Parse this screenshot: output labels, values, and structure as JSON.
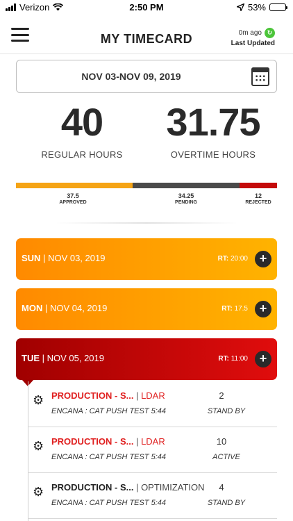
{
  "status_bar": {
    "carrier": "Verizon",
    "time": "2:50 PM",
    "battery": "53%",
    "battery_level": 0.53
  },
  "header": {
    "title": "MY TIMECARD",
    "updated_ago": "0m ago",
    "updated_label": "Last Updated"
  },
  "date_range": {
    "label": "NOV 03-NOV 09, 2019"
  },
  "hours": {
    "regular": {
      "value": "40",
      "label": "REGULAR HOURS"
    },
    "overtime": {
      "value": "31.75",
      "label": "OVERTIME HOURS"
    }
  },
  "breakdown": [
    {
      "value": "37.5",
      "label": "APPROVED",
      "color": "#f5a415"
    },
    {
      "value": "34.25",
      "label": "PENDING",
      "color": "#4a4a4a"
    },
    {
      "value": "12",
      "label": "REJECTED",
      "color": "#c40a0a"
    }
  ],
  "days": [
    {
      "day": "SUN",
      "date": "| NOV 03, 2019",
      "rt_label": "RT:",
      "rt_value": "20:00",
      "style": "orange"
    },
    {
      "day": "MON",
      "date": "| NOV 04, 2019",
      "rt_label": "RT:",
      "rt_value": "17.5",
      "style": "orange"
    },
    {
      "day": "TUE",
      "date": "| NOV 05, 2019",
      "rt_label": "RT:",
      "rt_value": "11:00",
      "style": "red"
    }
  ],
  "entries": [
    {
      "job": "PRODUCTION - S...",
      "job_color": "#e02020",
      "sep": " | ",
      "category": "LDAR",
      "category_color": "#e02020",
      "sub": "ENCANA : CAT PUSH TEST 5:44",
      "qty": "2",
      "status": "STAND BY"
    },
    {
      "job": "PRODUCTION - S...",
      "job_color": "#e02020",
      "sep": " | ",
      "category": "LDAR",
      "category_color": "#e02020",
      "sub": "ENCANA : CAT PUSH TEST 5:44",
      "qty": "10",
      "status": "ACTIVE"
    },
    {
      "job": "PRODUCTION - S...",
      "job_color": "#222222",
      "sep": " | ",
      "category": "OPTIMIZATION",
      "category_color": "#444444",
      "sub": "ENCANA : CAT PUSH TEST 5:44",
      "qty": "4",
      "status": "STAND BY"
    }
  ]
}
